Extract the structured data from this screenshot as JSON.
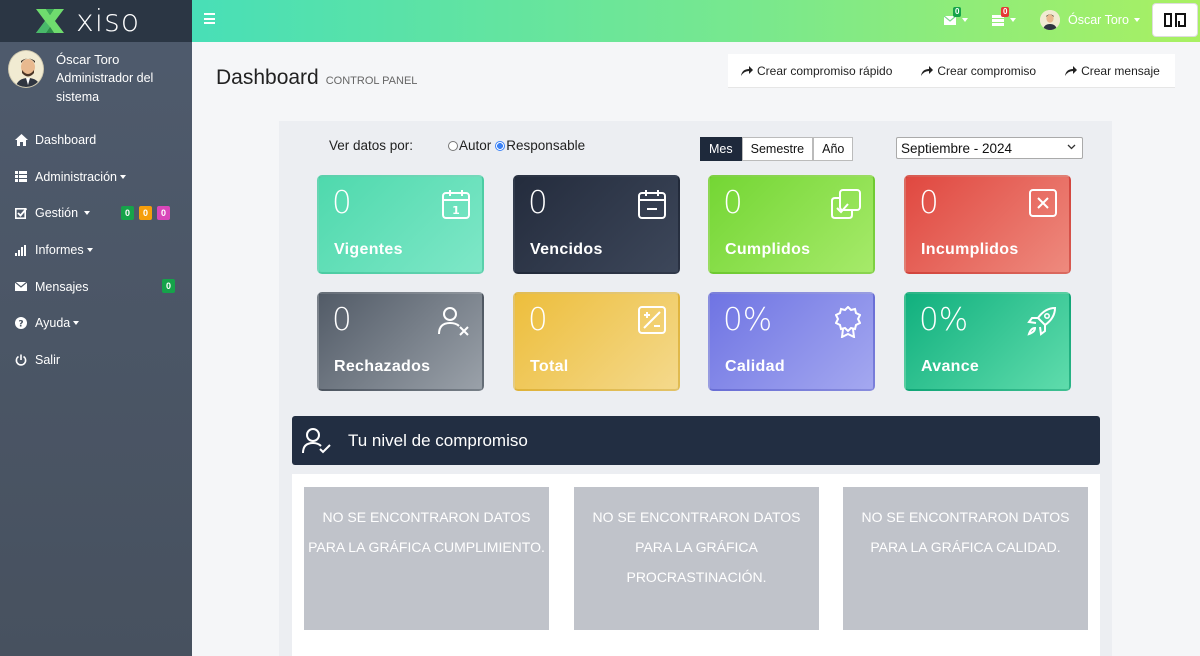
{
  "app": {
    "logo_text": "xiso"
  },
  "user": {
    "name": "Óscar Toro",
    "role": "Administrador del sistema",
    "top_name": "Óscar Toro"
  },
  "sidebar": {
    "items": [
      {
        "label": "Dashboard",
        "icon": "home-icon"
      },
      {
        "label": "Administración",
        "icon": "list-icon"
      },
      {
        "label": "Gestión",
        "icon": "checkbox-icon",
        "badges": [
          "0",
          "0",
          "0"
        ]
      },
      {
        "label": "Informes",
        "icon": "bar-chart-icon"
      },
      {
        "label": "Mensajes",
        "icon": "envelope-icon",
        "badge": "0"
      },
      {
        "label": "Ayuda",
        "icon": "question-icon"
      },
      {
        "label": "Salir",
        "icon": "power-icon"
      }
    ]
  },
  "topbar": {
    "mail_count": "0",
    "tasks_count": "0"
  },
  "header": {
    "title": "Dashboard",
    "subtitle": "CONTROL PANEL"
  },
  "actions": {
    "quick": "Crear compromiso rápido",
    "create": "Crear compromiso",
    "message": "Crear mensaje"
  },
  "filters": {
    "label": "Ver datos por:",
    "radio_author": "Autor",
    "radio_responsible": "Responsable",
    "selected_radio": "Responsable",
    "period_options": [
      "Mes",
      "Semestre",
      "Año"
    ],
    "period_selected": "Mes",
    "month_value": "Septiembre - 2024"
  },
  "cards": [
    {
      "value": "0",
      "label": "Vigentes",
      "icon": "calendar-one-icon",
      "color": "#53dcb2"
    },
    {
      "value": "0",
      "label": "Vencidos",
      "icon": "calendar-minus-icon",
      "color": "#2b3447"
    },
    {
      "value": "0",
      "label": "Cumplidos",
      "icon": "copy-check-icon",
      "color": "#7ddc3a"
    },
    {
      "value": "0",
      "label": "Incumplidos",
      "icon": "x-square-icon",
      "color": "#e4524a"
    },
    {
      "value": "0",
      "label": "Rechazados",
      "icon": "user-x-icon",
      "color": "#5c6571"
    },
    {
      "value": "0",
      "label": "Total",
      "icon": "plus-minus-icon",
      "color": "#efc445"
    },
    {
      "value": "0%",
      "label": "Calidad",
      "icon": "award-icon",
      "color": "#7b7fe6"
    },
    {
      "value": "0%",
      "label": "Avance",
      "icon": "rocket-icon",
      "color": "#1ebf8a"
    }
  ],
  "commitment": {
    "title": "Tu nivel de compromiso"
  },
  "charts": {
    "cumplimiento": "NO SE ENCONTRARON DATOS PARA LA GRÁFICA CUMPLIMIENTO.",
    "procrastinacion": "NO SE ENCONTRARON DATOS PARA LA GRÁFICA PROCRASTINACIÓN.",
    "calidad": "NO SE ENCONTRARON DATOS PARA LA GRÁFICA CALIDAD."
  }
}
